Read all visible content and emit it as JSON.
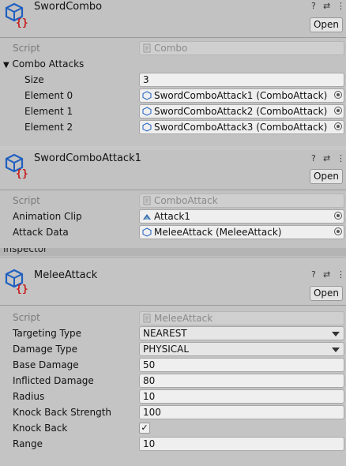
{
  "panels": [
    {
      "title": "SwordCombo",
      "open_label": "Open",
      "script_label": "Script",
      "script_value": "Combo",
      "group_label": "Combo Attacks",
      "size_label": "Size",
      "size_value": "3",
      "elements": [
        {
          "label": "Element 0",
          "value": "SwordComboAttack1 (ComboAttack)"
        },
        {
          "label": "Element 1",
          "value": "SwordComboAttack2 (ComboAttack)"
        },
        {
          "label": "Element 2",
          "value": "SwordComboAttack3 (ComboAttack)"
        }
      ]
    },
    {
      "title": "SwordComboAttack1",
      "open_label": "Open",
      "script_label": "Script",
      "script_value": "ComboAttack",
      "clip_label": "Animation Clip",
      "clip_value": "Attack1",
      "data_label": "Attack Data",
      "data_value": "MeleeAttack (MeleeAttack)"
    },
    {
      "tab_label": "Inspector",
      "title": "MeleeAttack",
      "open_label": "Open",
      "script_label": "Script",
      "script_value": "MeleeAttack",
      "targeting_label": "Targeting Type",
      "targeting_value": "NEAREST",
      "damage_type_label": "Damage Type",
      "damage_type_value": "PHYSICAL",
      "base_damage_label": "Base Damage",
      "base_damage_value": "50",
      "inflicted_label": "Inflicted Damage",
      "inflicted_value": "80",
      "radius_label": "Radius",
      "radius_value": "10",
      "knockback_strength_label": "Knock Back Strength",
      "knockback_strength_value": "100",
      "knockback_label": "Knock Back",
      "knockback_checked": true,
      "knockback_check_glyph": "✓",
      "range_label": "Range",
      "range_value": "10"
    }
  ],
  "header_icons": {
    "help": "?",
    "settings": "⇄",
    "more": "⋮"
  },
  "icons": {
    "asset": "scriptable-object-icon",
    "object_field": "script-icon",
    "clip": "animation-clip-icon"
  },
  "colors": {
    "cube_blue": "#1f5fbf",
    "braces_red": "#c81e1e"
  }
}
